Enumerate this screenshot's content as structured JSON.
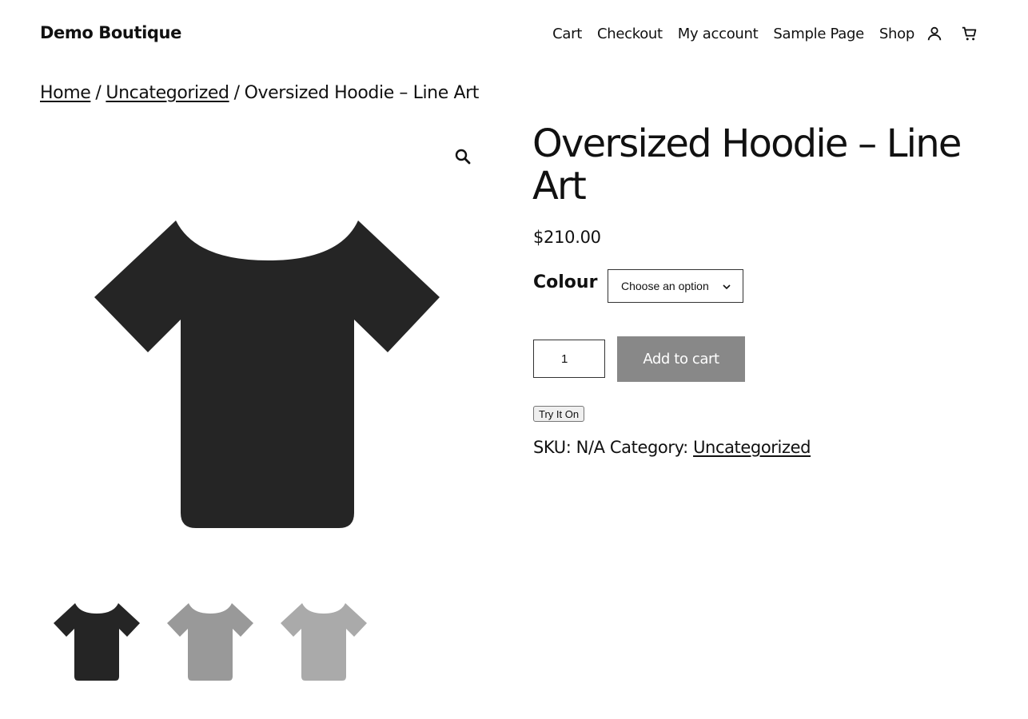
{
  "header": {
    "site_title": "Demo Boutique",
    "nav": [
      {
        "label": "Cart"
      },
      {
        "label": "Checkout"
      },
      {
        "label": "My account"
      },
      {
        "label": "Sample Page"
      },
      {
        "label": "Shop"
      }
    ],
    "icons": {
      "account": "account-icon",
      "cart": "cart-icon"
    }
  },
  "breadcrumb": {
    "home": "Home",
    "category": "Uncategorized",
    "current": "Oversized Hoodie – Line Art",
    "separator": "/"
  },
  "gallery": {
    "zoom_icon": "magnifier-icon",
    "main_image_color": "#252525",
    "thumbnails": [
      {
        "color": "#252525"
      },
      {
        "color": "#999999"
      },
      {
        "color": "#aaaaaa"
      }
    ]
  },
  "product": {
    "title": "Oversized Hoodie – Line Art",
    "price": "$210.00",
    "colour_label": "Colour",
    "colour_select_value": "Choose an option",
    "quantity": "1",
    "add_to_cart_label": "Add to cart",
    "try_on_label": "Try It On",
    "meta": {
      "sku_label": "SKU:",
      "sku_value": "N/A",
      "category_label": "Category:",
      "category_value": "Uncategorized"
    }
  },
  "colors": {
    "text": "#111111",
    "button_bg": "#888888",
    "button_text": "#ffffff"
  }
}
